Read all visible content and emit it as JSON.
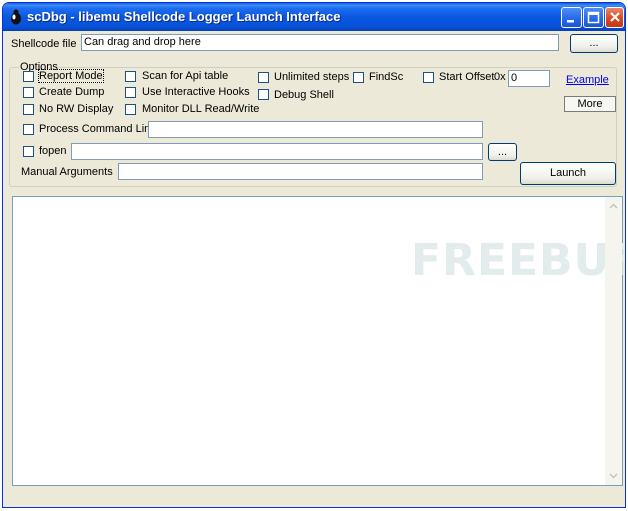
{
  "window": {
    "title": "scDbg - libemu Shellcode Logger Launch Interface"
  },
  "shellcode": {
    "label": "Shellcode file",
    "value": "Can drag and drop here",
    "browse_label": "..."
  },
  "options": {
    "group_label": "Options",
    "report_mode": "Report Mode",
    "create_dump": "Create Dump",
    "no_rw_display": "No RW Display",
    "scan_api_table": "Scan for Api table",
    "interactive_hooks": "Use Interactive Hooks",
    "monitor_dll": "Monitor DLL Read/Write",
    "unlimited_steps": "Unlimited steps",
    "debug_shell": "Debug Shell",
    "findsc": "FindSc",
    "start_offset": "Start Offset",
    "hex_prefix": "0x",
    "start_offset_value": "0",
    "example_link": "Example",
    "more_button": "More",
    "process_cmdline": "Process Command Line",
    "fopen": "fopen",
    "fopen_browse": "...",
    "manual_args": "Manual  Arguments",
    "launch_button": "Launch"
  },
  "output": {
    "watermark": "FREEBUF"
  },
  "colors": {
    "titlebar": "#0a57e0",
    "face": "#ece9d8",
    "link": "#0000ee"
  }
}
